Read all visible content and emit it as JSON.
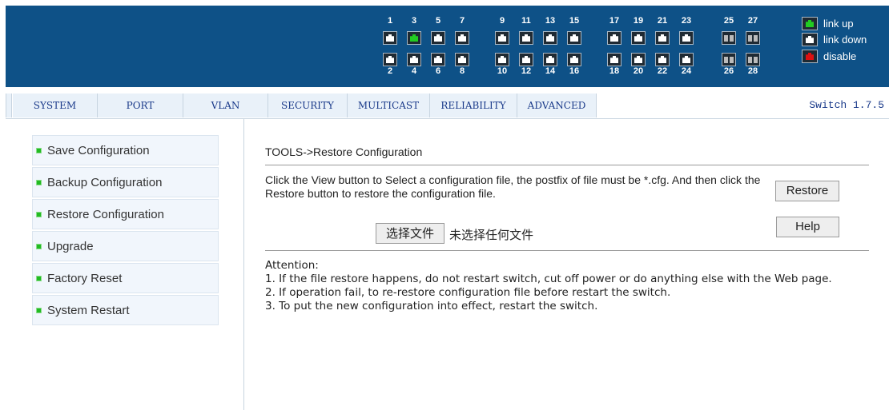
{
  "header": {
    "ports_top": [
      {
        "num": "1",
        "state": "down"
      },
      {
        "num": "3",
        "state": "up"
      },
      {
        "num": "5",
        "state": "down"
      },
      {
        "num": "7",
        "state": "down"
      },
      {
        "num": "9",
        "state": "down"
      },
      {
        "num": "11",
        "state": "down"
      },
      {
        "num": "13",
        "state": "down"
      },
      {
        "num": "15",
        "state": "down"
      },
      {
        "num": "17",
        "state": "down"
      },
      {
        "num": "19",
        "state": "down"
      },
      {
        "num": "21",
        "state": "down"
      },
      {
        "num": "23",
        "state": "down"
      },
      {
        "num": "25",
        "state": "sfp"
      },
      {
        "num": "27",
        "state": "sfp"
      }
    ],
    "ports_bottom": [
      {
        "num": "2",
        "state": "down"
      },
      {
        "num": "4",
        "state": "down"
      },
      {
        "num": "6",
        "state": "down"
      },
      {
        "num": "8",
        "state": "down"
      },
      {
        "num": "10",
        "state": "down"
      },
      {
        "num": "12",
        "state": "down"
      },
      {
        "num": "14",
        "state": "down"
      },
      {
        "num": "16",
        "state": "down"
      },
      {
        "num": "18",
        "state": "down"
      },
      {
        "num": "20",
        "state": "down"
      },
      {
        "num": "22",
        "state": "down"
      },
      {
        "num": "24",
        "state": "down"
      },
      {
        "num": "26",
        "state": "sfp"
      },
      {
        "num": "28",
        "state": "sfp"
      }
    ],
    "legend": {
      "link_up": "link up",
      "link_down": "link down",
      "disable": "disable"
    },
    "colors": {
      "banner": "#0e5187",
      "link_up": "#22cc22",
      "disable": "#dd1111"
    }
  },
  "menu": {
    "items": [
      {
        "label": "SYSTEM"
      },
      {
        "label": "PORT"
      },
      {
        "label": "VLAN"
      },
      {
        "label": "SECURITY"
      },
      {
        "label": "MULTICAST"
      },
      {
        "label": "RELIABILITY"
      },
      {
        "label": "ADVANCED"
      }
    ],
    "version": "Switch 1.7.5"
  },
  "sidebar": {
    "items": [
      {
        "label": "Save Configuration"
      },
      {
        "label": "Backup Configuration"
      },
      {
        "label": "Restore Configuration"
      },
      {
        "label": "Upgrade"
      },
      {
        "label": "Factory Reset"
      },
      {
        "label": "System Restart"
      }
    ]
  },
  "main": {
    "title": "TOOLS->Restore Configuration",
    "instructions": "Click the View button to Select a configuration file, the postfix of file must be *.cfg. And then click the Restore button to restore the configuration file.",
    "restore_label": "Restore",
    "help_label": "Help",
    "file_button_label": "选择文件",
    "file_status": "未选择任何文件",
    "attention": {
      "heading": "Attention:",
      "lines": [
        "1. If the file restore happens, do not restart switch, cut off power or do anything else with the Web page.",
        "2. If operation fail, to re-restore configuration file before restart the switch.",
        "3. To put the new configuration into effect, restart the switch."
      ]
    }
  }
}
